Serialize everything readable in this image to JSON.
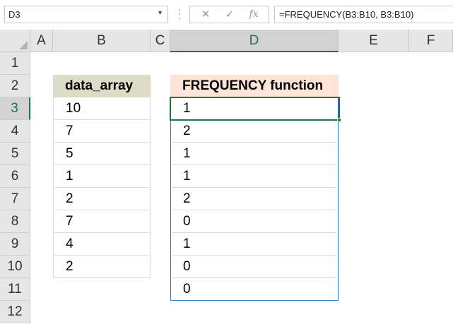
{
  "name_box": {
    "value": "D3"
  },
  "formula_bar": {
    "cancel_glyph": "✕",
    "enter_glyph": "✓",
    "function_glyph": "fx",
    "formula": "=FREQUENCY(B3:B10, B3:B10)"
  },
  "columns": [
    "A",
    "B",
    "C",
    "D",
    "E",
    "F"
  ],
  "rows": [
    "1",
    "2",
    "3",
    "4",
    "5",
    "6",
    "7",
    "8",
    "9",
    "10",
    "11",
    "12"
  ],
  "selected": {
    "column": "D",
    "row": "3"
  },
  "data_array": {
    "header": "data_array",
    "values": [
      "10",
      "7",
      "5",
      "1",
      "2",
      "7",
      "4",
      "2"
    ]
  },
  "frequency": {
    "header": "FREQUENCY function",
    "values": [
      "1",
      "2",
      "1",
      "1",
      "2",
      "0",
      "1",
      "0",
      "0"
    ]
  },
  "colors": {
    "accent_green": "#217346",
    "array_border_blue": "#2e75b6",
    "data_array_header_fill": "#dcdcc8",
    "frequency_header_fill": "#fce4d6"
  }
}
